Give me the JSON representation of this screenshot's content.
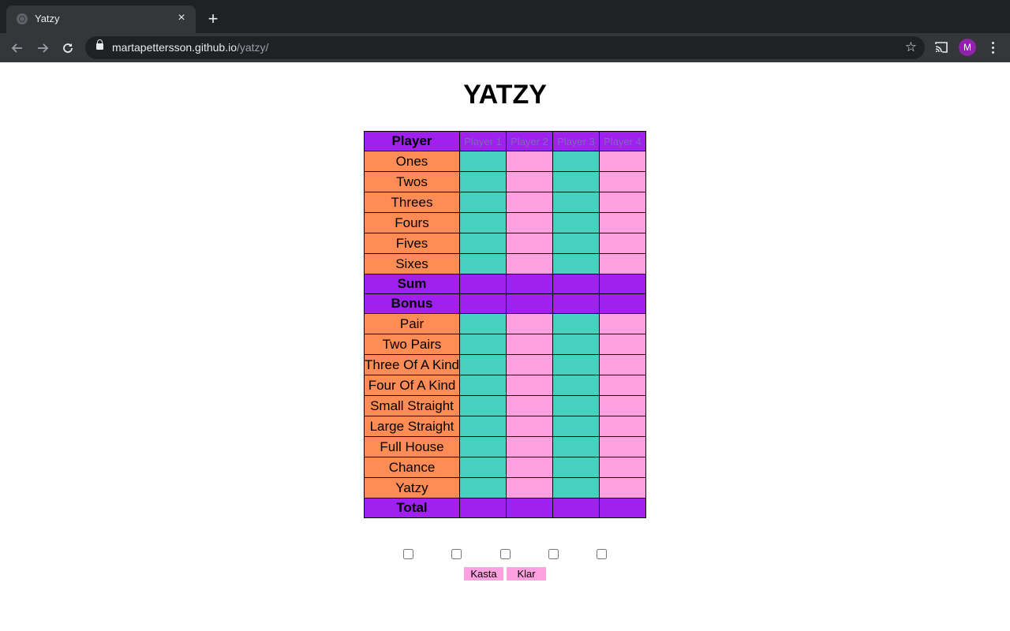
{
  "browser": {
    "tab_title": "Yatzy",
    "tab_close": "×",
    "new_tab": "+",
    "url_host": "martapettersson.github.io",
    "url_path": "/yatzy/",
    "avatar_letter": "M"
  },
  "page": {
    "title": "YATZY"
  },
  "table": {
    "header_label": "Player",
    "players": [
      "Player 1",
      "Player 2",
      "Player 3",
      "Player 4"
    ],
    "rows": [
      {
        "label": "Ones"
      },
      {
        "label": "Twos"
      },
      {
        "label": "Threes"
      },
      {
        "label": "Fours"
      },
      {
        "label": "Fives"
      },
      {
        "label": "Sixes"
      },
      {
        "label": "Sum"
      },
      {
        "label": "Bonus"
      },
      {
        "label": "Pair"
      },
      {
        "label": "Two Pairs"
      },
      {
        "label": "Three Of A Kind"
      },
      {
        "label": "Four Of A Kind"
      },
      {
        "label": "Small Straight"
      },
      {
        "label": "Large Straight"
      },
      {
        "label": "Full House"
      },
      {
        "label": "Chance"
      },
      {
        "label": "Yatzy"
      },
      {
        "label": "Total"
      }
    ]
  },
  "dice": {
    "checked": [
      false,
      false,
      false,
      false,
      false
    ]
  },
  "buttons": {
    "roll": "Kasta",
    "done": "Klar"
  },
  "colors": {
    "label_bg": "#ff8c55",
    "purple": "#a020f0",
    "teal": "#48d1c1",
    "pink": "#ffa0e0"
  }
}
